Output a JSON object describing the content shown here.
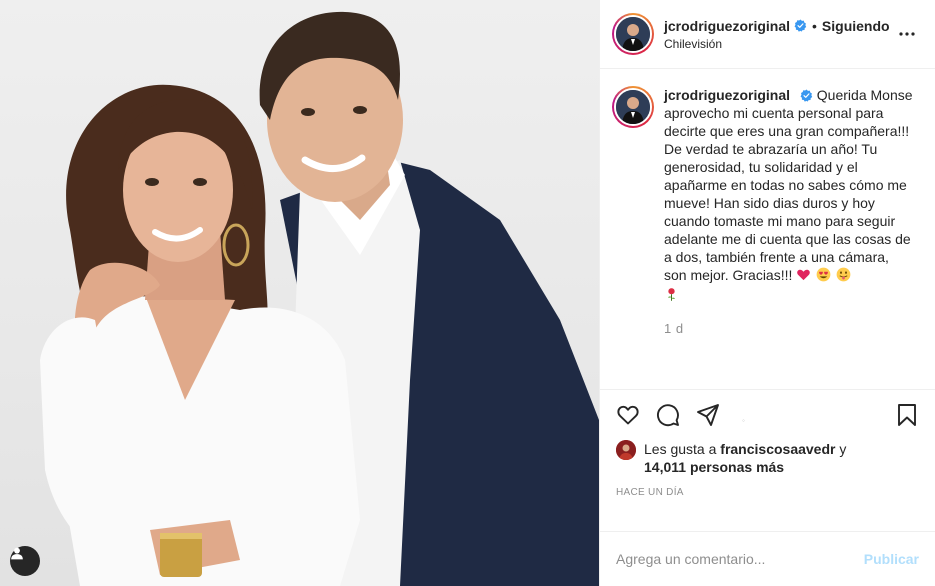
{
  "post": {
    "author": {
      "username": "jcrodriguezoriginal",
      "verified": true,
      "follow_status": "Siguiendo",
      "location": "Chilevisión"
    },
    "caption": {
      "text": "Querida Monse aprovecho mi cuenta personal para decirte que eres una gran compañera!!! De verdad te abrazaría un año! Tu generosidad, tu solidaridad y el apañarme en todas no sabes cómo me mueve! Han sido dias duros y hoy cuando tomaste mi mano para seguir adelante me di cuenta que las cosas de a dos, también frente a una cámara, son mejor. Gracias!!!",
      "emojis": [
        "red-heart-emoji",
        "heart-eyes-emoji",
        "tongue-out-emoji",
        "rose-emoji"
      ],
      "relative_time": "1 d"
    },
    "likes": {
      "prefix": "Les gusta a",
      "first_liker": "franciscosaavedr",
      "connector": "y",
      "count_text": "14,011 personas más"
    },
    "posted_ago": "HACE UN DÍA",
    "comment_box": {
      "placeholder": "Agrega un comentario...",
      "publish_label": "Publicar"
    }
  },
  "colors": {
    "verified_blue": "#3897f0",
    "secondary_text": "#8e8e8e",
    "publish_disabled": "#b2dffc",
    "heart_red": "#e0245e"
  },
  "icons": [
    "heart-icon",
    "comment-icon",
    "share-icon",
    "bookmark-icon",
    "more-options-icon",
    "user-tag-icon",
    "verified-badge-icon"
  ]
}
